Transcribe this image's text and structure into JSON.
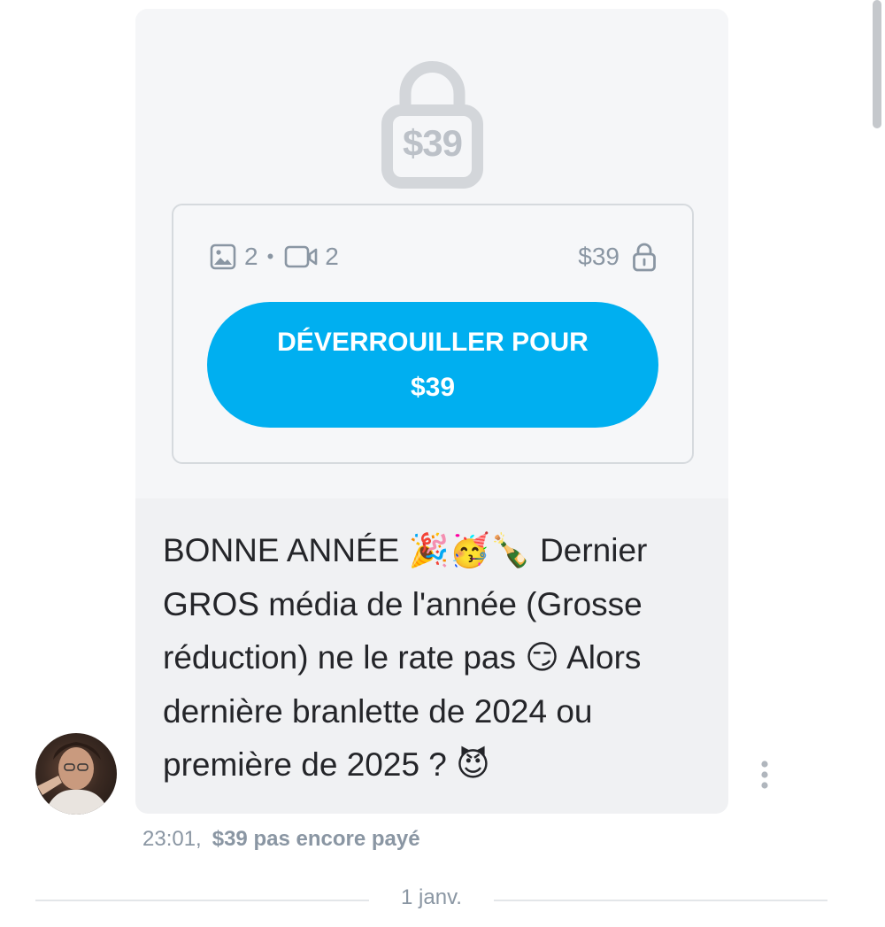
{
  "message": {
    "locked_preview": {
      "lock_price": "$39",
      "media": {
        "photos_icon": "image-icon",
        "photos_count": "2",
        "separator": "•",
        "videos_icon": "video-icon",
        "videos_count": "2"
      },
      "price": "$39",
      "price_icon": "lock-icon",
      "unlock_button": {
        "line1": "DÉVERROUILLER POUR",
        "line2": "$39"
      }
    },
    "text_lines": [
      "BONNE ANNÉE 🎉🥳🍾 Dernier",
      "GROS média de l'année (Grosse",
      "réduction) ne le rate pas 😏 Alors",
      "dernière branlette de 2024 ou",
      "première de 2025 ? 😈"
    ],
    "time": "23:01,",
    "payment_status": "$39 pas encore payé"
  },
  "date_divider": "1 janv.",
  "colors": {
    "accent": "#00aff0",
    "muted_text": "#8a96a3",
    "card_bg": "#f0f1f3"
  }
}
